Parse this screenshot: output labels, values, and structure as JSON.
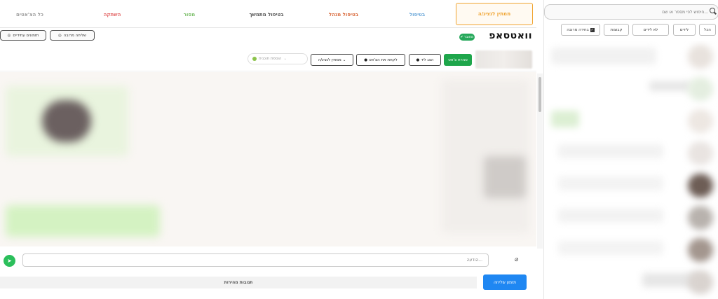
{
  "tabs": [
    {
      "label": "כל הצ'אטים",
      "color": "#9e9e9e"
    },
    {
      "label": "השתקה",
      "color": "#e46b6b"
    },
    {
      "label": "מסור",
      "color": "#7bbf6a"
    },
    {
      "label": "בטיפול מתמשך",
      "color": "#555555"
    },
    {
      "label": "בטיפול מנהל",
      "color": "#d96a3c"
    },
    {
      "label": "בטיפול",
      "color": "#6aa7d9"
    },
    {
      "label": "ממתין לנציג/ה",
      "color": "#f0a431",
      "active": true
    }
  ],
  "header": {
    "logo": "וואטסאפ",
    "logo_badge": "מחובר",
    "btn_bulk": "שליחה מרובה",
    "btn_future": "תזמונים עתידיים"
  },
  "toolbar": {
    "close_chat": "סגירת צ'אט",
    "show_lead": "הצג ליד",
    "take_chat": "לקחת את הצ'אט",
    "status_select": "ממתין לנציג/ה",
    "tag_placeholder": "הוספת תוכנית"
  },
  "compose": {
    "placeholder": "הודעה..."
  },
  "bottom": {
    "quick_replies": "תגובות מהירות",
    "schedule": "תזמון שליחה"
  },
  "sidebar": {
    "search_placeholder": "חיפוש לפי מספר או שם...",
    "filters": [
      {
        "label": "הכל"
      },
      {
        "label": "לידים"
      },
      {
        "label": "לא לידים"
      },
      {
        "label": "קבוצות"
      },
      {
        "label": "בחירה מרובה",
        "checkbox": true
      }
    ]
  },
  "colors": {
    "accent_green": "#1ea64b",
    "accent_blue": "#1f87f2",
    "active_tab_border": "#f0a431"
  }
}
